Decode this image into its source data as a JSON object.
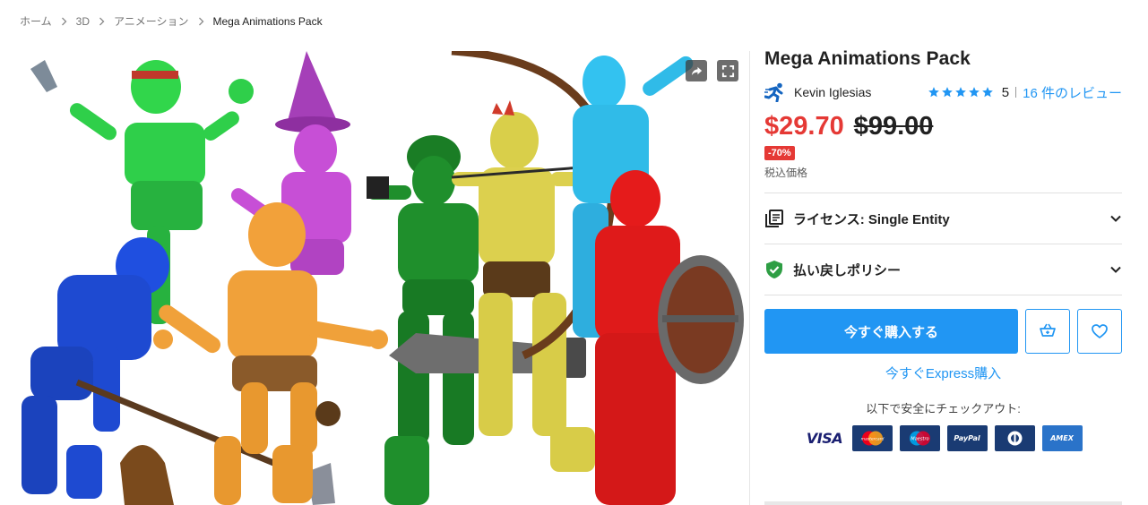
{
  "breadcrumb": {
    "items": [
      "ホーム",
      "3D",
      "アニメーション",
      "Mega Animations Pack"
    ]
  },
  "hero": {
    "share_icon": "share-icon",
    "fullscreen_icon": "fullscreen-icon"
  },
  "product": {
    "title": "Mega Animations Pack",
    "publisher": "Kevin Iglesias",
    "rating_value": "5",
    "stars": 5,
    "reviews_link": "16 件のレビュー",
    "price_sale": "$29.70",
    "price_original": "$99.00",
    "discount": "-70%",
    "tax_note": "税込価格"
  },
  "accordions": {
    "license": {
      "label": "ライセンス: Single Entity",
      "icon": "license-icon"
    },
    "refund": {
      "label": "払い戻しポリシー",
      "icon": "shield-check-icon"
    }
  },
  "actions": {
    "buy_now": "今すぐ購入する",
    "express": "今すぐExpress購入",
    "cart_icon": "add-to-cart-icon",
    "wishlist_icon": "heart-icon"
  },
  "checkout": {
    "label": "以下で安全にチェックアウト:",
    "methods": [
      "VISA",
      "mastercard",
      "Maestro",
      "PayPal",
      "Diners Club",
      "AMEX"
    ]
  },
  "colors": {
    "accent": "#2196f3",
    "sale": "#e53935",
    "star": "#2196f3"
  }
}
